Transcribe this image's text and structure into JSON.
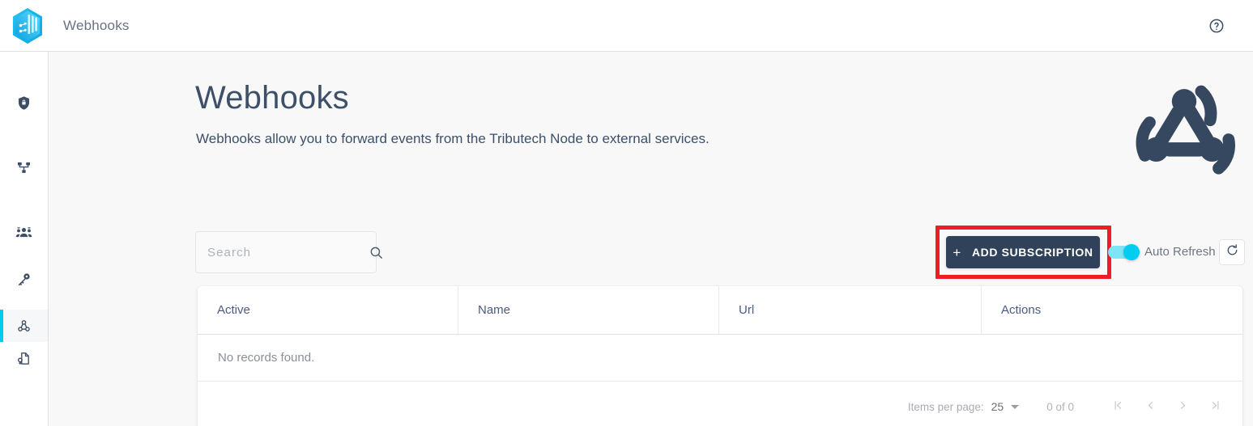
{
  "header": {
    "brand_logo_icon": "tributech-hexagon-logo",
    "title": "Webhooks",
    "help_icon": "help-circle-icon"
  },
  "sidebar": {
    "items": [
      {
        "icon": "shield-lock-icon",
        "name": "sidebar-item-security",
        "active": false
      },
      {
        "icon": "sitemap-hierarchy-icon",
        "name": "sidebar-item-topology",
        "active": false
      },
      {
        "icon": "people-group-icon",
        "name": "sidebar-item-users",
        "active": false
      },
      {
        "icon": "key-icon",
        "name": "sidebar-item-keys",
        "active": false
      },
      {
        "icon": "webhook-icon",
        "name": "sidebar-item-webhooks",
        "active": true
      },
      {
        "icon": "document-key-icon",
        "name": "sidebar-item-documents",
        "active": false
      }
    ]
  },
  "main": {
    "title": "Webhooks",
    "subtitle": "Webhooks allow you to forward events from the Tributech Node to external services.",
    "hero_icon": "webhook-logo"
  },
  "toolbar": {
    "search_placeholder": "Search",
    "search_value": "",
    "search_icon": "search-icon",
    "add_button_label": "ADD SUBSCRIPTION",
    "add_button_plus": "+",
    "auto_refresh_label": "Auto Refresh",
    "auto_refresh_on": true,
    "refresh_icon": "refresh-icon",
    "highlight_color": "#ee1c25"
  },
  "table": {
    "columns": [
      "Active",
      "Name",
      "Url",
      "Actions"
    ],
    "rows": [],
    "empty_message": "No records found."
  },
  "paginator": {
    "items_per_page_label": "Items per page:",
    "items_per_page_value": "25",
    "range_label": "0 of 0",
    "first_page_icon": "first-page-icon",
    "prev_page_icon": "previous-page-icon",
    "next_page_icon": "next-page-icon",
    "last_page_icon": "last-page-icon"
  },
  "colors": {
    "accent_cyan": "#00cdf0",
    "dark_slate": "#2f4259",
    "content_bg": "#f8f8f8",
    "highlight_red": "#ee1c25"
  }
}
